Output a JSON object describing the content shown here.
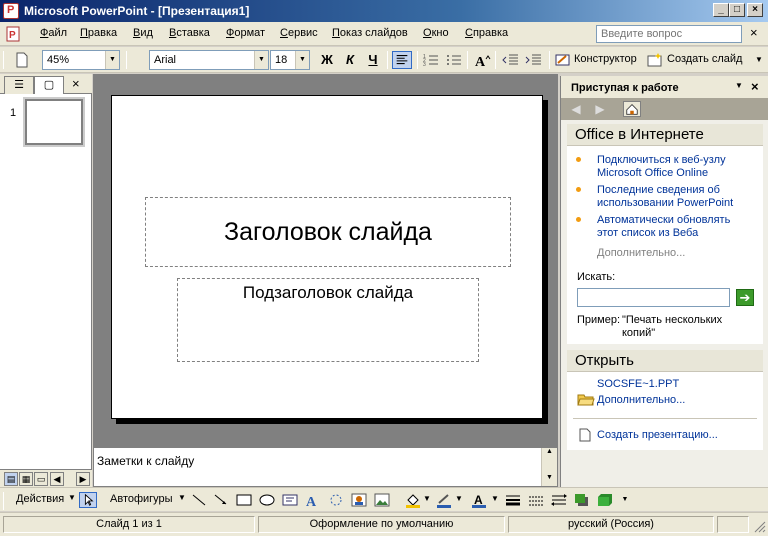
{
  "window": {
    "title": "Microsoft PowerPoint - [Презентация1]",
    "minimize_glyph": "_",
    "maximize_glyph": "□",
    "close_glyph": "×"
  },
  "menu": {
    "items": [
      "Файл",
      "Правка",
      "Вид",
      "Вставка",
      "Формат",
      "Сервис",
      "Показ слайдов",
      "Окно",
      "Справка"
    ],
    "help_placeholder": "Введите вопрос",
    "close_doc_glyph": "×"
  },
  "toolbar": {
    "zoom": "45%",
    "font": "Arial",
    "font_size": "18",
    "bold_label": "Ж",
    "italic_label": "К",
    "underline_label": "Ч",
    "designer_label": "Конструктор",
    "new_slide_label": "Создать слайд"
  },
  "thumbnails": {
    "slide_number": "1",
    "outline_tab_glyph": "☰",
    "slides_tab_glyph": "▢",
    "close_glyph": "×"
  },
  "slide": {
    "title_placeholder": "Заголовок слайда",
    "subtitle_placeholder": "Подзаголовок слайда"
  },
  "notes": {
    "placeholder": "Заметки к слайду"
  },
  "taskpane": {
    "title": "Приступая к работе",
    "office_online_header": "Office в Интернете",
    "links": [
      "Подключиться к веб-узлу Microsoft Office Online",
      "Последние сведения об использовании PowerPoint",
      "Автоматически обновлять этот список из Веба"
    ],
    "more_online": "Дополнительно...",
    "search_label": "Искать:",
    "search_value": "",
    "example_label": "Пример:",
    "example_text": "\"Печать нескольких копий\"",
    "open_header": "Открыть",
    "recent_file": "SOCSFE~1.PPT",
    "more_open": "Дополнительно...",
    "create_presentation": "Создать презентацию..."
  },
  "drawing": {
    "actions_label": "Действия",
    "autoshapes_label": "Автофигуры"
  },
  "status": {
    "slide_info": "Слайд 1 из 1",
    "design": "Оформление по умолчанию",
    "language": "русский (Россия)"
  },
  "colors": {
    "titlebar_start": "#0a246a",
    "link": "#003399",
    "bullet": "#f29c11",
    "go_button": "#3c9a2a"
  }
}
